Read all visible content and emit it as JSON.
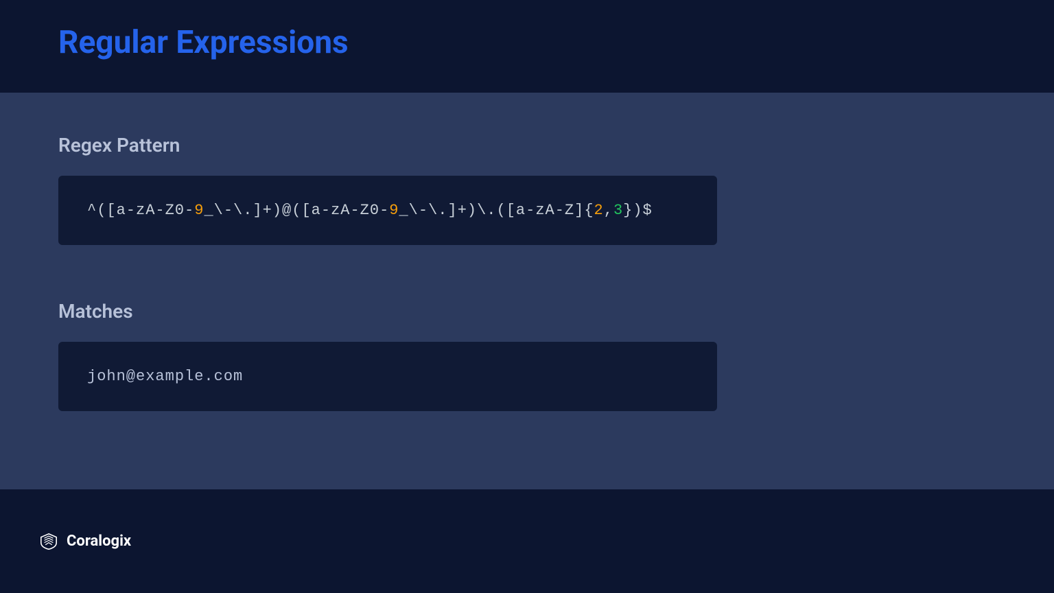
{
  "header": {
    "title": "Regular Expressions"
  },
  "sections": {
    "pattern": {
      "label": "Regex Pattern",
      "tokens": [
        {
          "text": "^([a-zA-Z0-",
          "cls": "regex-white"
        },
        {
          "text": "9",
          "cls": "regex-orange"
        },
        {
          "text": "_\\-\\.]+)@([a-zA-Z0-",
          "cls": "regex-white"
        },
        {
          "text": "9",
          "cls": "regex-orange"
        },
        {
          "text": "_\\-\\.]+)\\.([a-zA-Z]{",
          "cls": "regex-white"
        },
        {
          "text": "2",
          "cls": "regex-orange"
        },
        {
          "text": ",",
          "cls": "regex-white"
        },
        {
          "text": "3",
          "cls": "regex-green"
        },
        {
          "text": "})$",
          "cls": "regex-white"
        }
      ]
    },
    "matches": {
      "label": "Matches",
      "value": "john@example.com"
    }
  },
  "footer": {
    "brand": "Coralogix"
  }
}
